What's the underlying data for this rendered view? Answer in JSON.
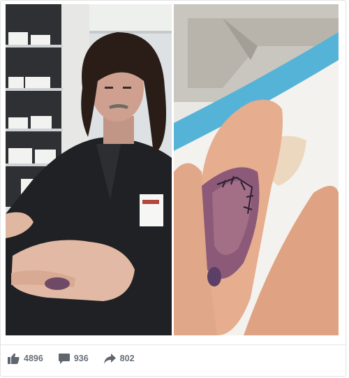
{
  "post": {
    "stats": {
      "likes": "4896",
      "comments": "936",
      "shares": "802"
    },
    "icons": {
      "like": "thumbs-up-icon",
      "comment": "comment-bubble-icon",
      "share": "share-arrow-icon"
    },
    "colors": {
      "icon": "#5f666e",
      "count": "#6a7078"
    }
  }
}
